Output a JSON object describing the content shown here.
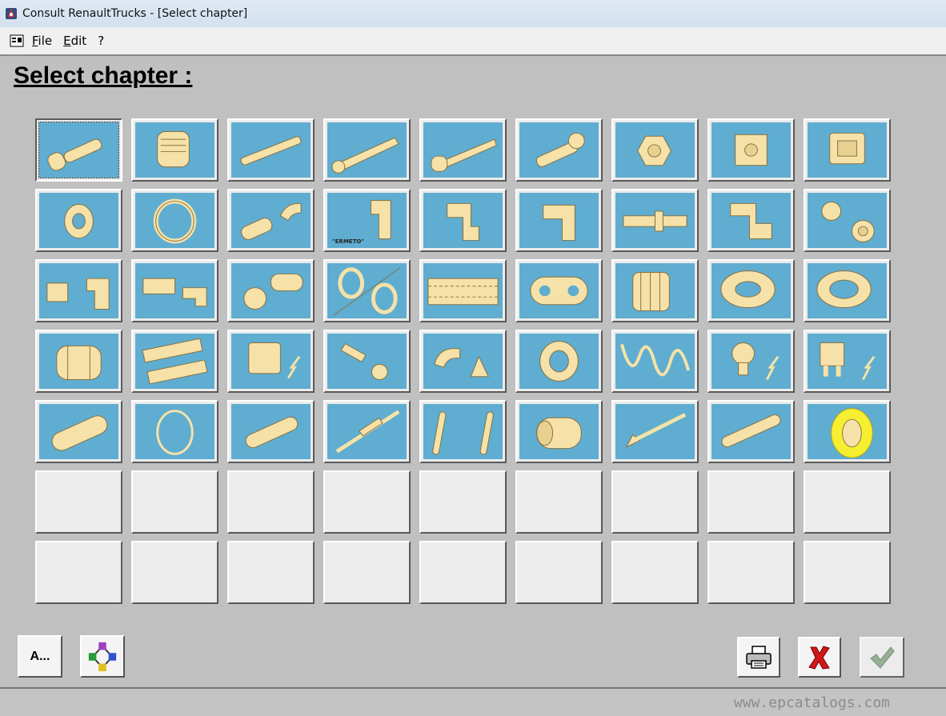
{
  "window": {
    "title": "Consult RenaultTrucks - [Select chapter]"
  },
  "menu": {
    "items": [
      "File",
      "Edit",
      "?"
    ]
  },
  "page": {
    "heading": "Select chapter :"
  },
  "grid": {
    "rows": [
      [
        "bolt",
        "plug",
        "threaded-rod",
        "wood-screw",
        "lag-screw",
        "banjo-bolt",
        "hex-nut",
        "square-nut",
        "cage-nut"
      ],
      [
        "washer",
        "hose-clamp",
        "pipe-elbow",
        "ermeto-elbow",
        "elbow-fitting",
        "tee-fitting",
        "hose-connector",
        "union-elbow",
        "quick-connector"
      ],
      [
        "push-connector",
        "elbow-adapter",
        "rotating-seal",
        "o-ring-seal",
        "braided-hose",
        "chain",
        "roller-bearing",
        "ball-bearing",
        "tapered-bearing"
      ],
      [
        "grease-nipple",
        "terminal-strip",
        "relay",
        "cable-lugs",
        "rubber-grommets",
        "grommet",
        "spring",
        "bulb",
        "fuse"
      ],
      [
        "sleeve",
        "snap-ring",
        "key",
        "gas-strut",
        "clips",
        "bushing",
        "rivet",
        "dowel-pin",
        "reflector"
      ],
      [
        "",
        "",
        "",
        "",
        "",
        "",
        "",
        "",
        ""
      ],
      [
        "",
        "",
        "",
        "",
        "",
        "",
        "",
        "",
        ""
      ]
    ],
    "ermeto_label": "\"ERMETO\"",
    "selected": "bolt"
  },
  "buttons": {
    "alpha_label": "A..."
  },
  "watermark": "www.epcatalogs.com",
  "colors": {
    "tile_fill": "#5fadd0",
    "part_fill": "#f6e2a8",
    "cancel_red": "#d01818",
    "ok_green": "#7a9a7a"
  }
}
